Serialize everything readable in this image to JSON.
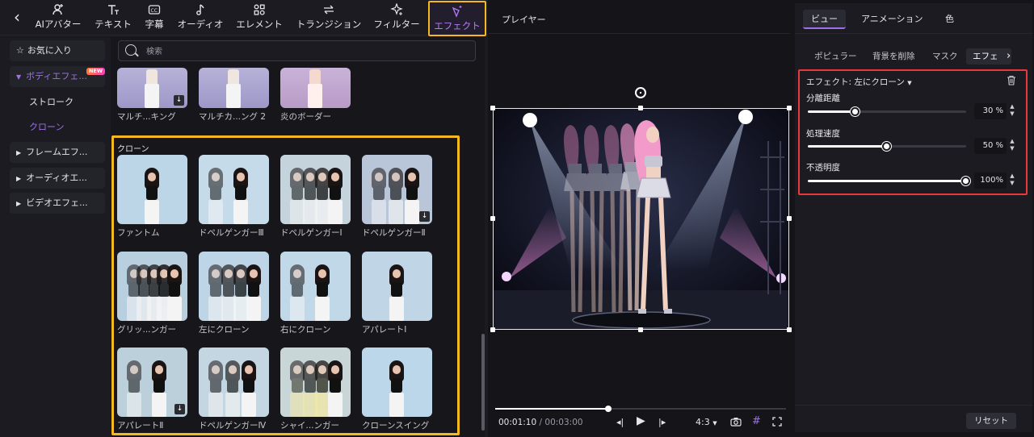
{
  "toolbar": {
    "back": "‹",
    "tools": [
      {
        "label": "AIアバター",
        "icon": "person-plus-icon"
      },
      {
        "label": "テキスト",
        "icon": "text-icon"
      },
      {
        "label": "字幕",
        "icon": "caption-icon"
      },
      {
        "label": "オーディオ",
        "icon": "music-note-icon"
      },
      {
        "label": "エレメント",
        "icon": "elements-icon"
      },
      {
        "label": "トランジション",
        "icon": "transition-arrows-icon"
      },
      {
        "label": "フィルター",
        "icon": "sparkle-icon"
      },
      {
        "label": "エフェクト",
        "icon": "effect-wand-icon",
        "active": true
      }
    ]
  },
  "sidebar": {
    "favorites": "お気に入り",
    "body_effects": "ボディエフェ...",
    "new_badge": "NEW",
    "stroke": "ストローク",
    "clone": "クローン",
    "frame_effects": "フレームエフ...",
    "audio_effects": "オーディオエ...",
    "video_effects": "ビデオエフェ..."
  },
  "search": {
    "placeholder": "検索"
  },
  "top_row": [
    {
      "caption": "マルチ...キング"
    },
    {
      "caption": "マルチカ...ング 2"
    },
    {
      "caption": "炎のボーダー"
    }
  ],
  "section": {
    "title": "クローン"
  },
  "clone_items": [
    {
      "caption": "ファントム"
    },
    {
      "caption": "ドペルゲンガーⅢ"
    },
    {
      "caption": "ドペルゲンガーⅠ"
    },
    {
      "caption": "ドペルゲンガーⅡ"
    },
    {
      "caption": "グリッ...ンガー"
    },
    {
      "caption": "左にクローン"
    },
    {
      "caption": "右にクローン"
    },
    {
      "caption": "アパレートⅠ"
    },
    {
      "caption": "アパレートⅡ"
    },
    {
      "caption": "ドペルゲンガーⅣ"
    },
    {
      "caption": "シャイ...ンガー"
    },
    {
      "caption": "クローンスイング"
    }
  ],
  "player": {
    "title": "プレイヤー",
    "time_current": "00:01:10",
    "time_sep": " / ",
    "time_total": "00:03:00",
    "progress": 0.39,
    "aspect": "4:3"
  },
  "right_panel": {
    "tabs": [
      "ビュー",
      "アニメーション",
      "色"
    ],
    "subtabs": [
      "ポピュラー",
      "背景を削除",
      "マスク",
      "エフェ"
    ],
    "effect_title": "エフェクト: 左にクローン",
    "params": [
      {
        "label": "分離距離",
        "value": "30 %",
        "fraction": 0.3
      },
      {
        "label": "処理速度",
        "value": "50 %",
        "fraction": 0.5
      },
      {
        "label": "不透明度",
        "value": "100%",
        "fraction": 1.0
      }
    ],
    "reset": "リセット"
  },
  "colors": {
    "accent": "#a070ec",
    "highlight_yellow": "#f6b81f",
    "highlight_red": "#e83a3a"
  }
}
